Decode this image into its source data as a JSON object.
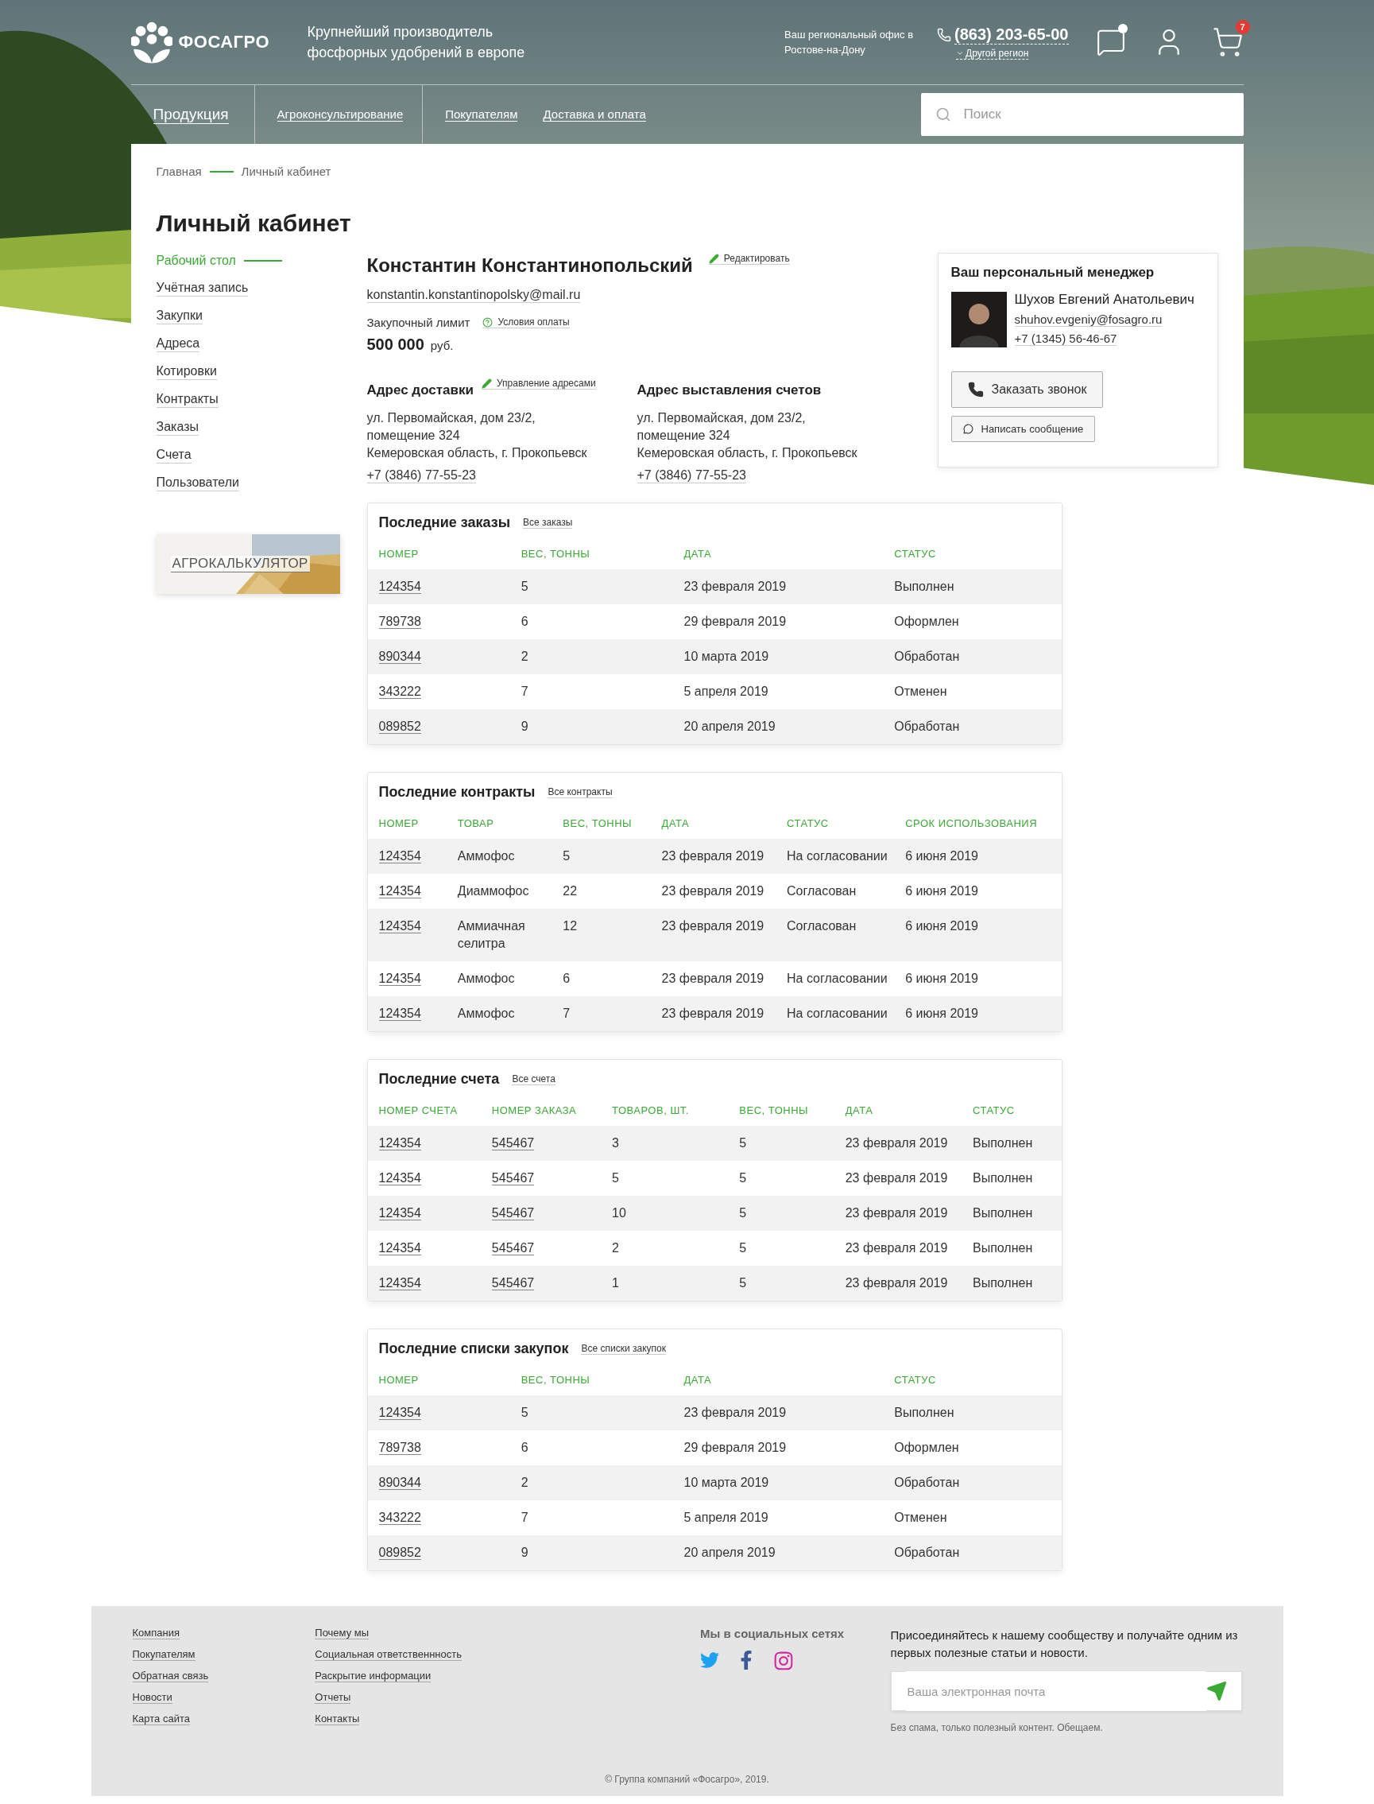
{
  "header": {
    "brand": "ФОСАГРО",
    "tagline": "Крупнейший производитель фосфорных удобрений в европе",
    "office": "Ваш региональный офис в Ростове-на-Дону",
    "phone": "(863) 203-65-00",
    "region_link": "Другой регион",
    "cart_count": "7"
  },
  "nav": [
    {
      "label": "Продукция",
      "selected": true
    },
    {
      "label": "Агроконсультирование",
      "selected": false
    },
    {
      "label": "Покупателям",
      "selected": false
    },
    {
      "label": "Доставка и оплата",
      "selected": false
    }
  ],
  "search": {
    "placeholder": "Поиск"
  },
  "breadcrumbs": [
    "Главная",
    "Личный кабинет"
  ],
  "page_title": "Личный кабинет",
  "sidebar": {
    "items": [
      {
        "label": "Рабочий стол",
        "selected": true
      },
      {
        "label": "Учётная запись",
        "selected": false
      },
      {
        "label": "Закупки",
        "selected": false
      },
      {
        "label": "Адреса",
        "selected": false
      },
      {
        "label": "Котировки",
        "selected": false
      },
      {
        "label": "Контракты",
        "selected": false
      },
      {
        "label": "Заказы",
        "selected": false
      },
      {
        "label": "Счета",
        "selected": false
      },
      {
        "label": "Пользователи",
        "selected": false
      }
    ],
    "banner": {
      "kind": "picture",
      "label": "АГРОКАЛЬКУЛЯТОР"
    }
  },
  "profile": {
    "name": "Константин Константинопольский",
    "edit_link": "Редактировать",
    "email": "konstantin.konstantinopolsky@mail.ru",
    "limit_label": "Закупочный лимит",
    "terms_link": "Условия оплаты",
    "limit_value": "500 000",
    "currency": "руб."
  },
  "addresses": [
    {
      "title": "Адрес доставки",
      "manage_link": "Управление адресами",
      "lines": [
        "ул. Первомайская, дом 23/2,",
        "помещение 324",
        "Кемеровская область, г. Прокопьевск"
      ],
      "phone": "+7 (3846) 77-55-23"
    },
    {
      "title": "Адрес выставления счетов",
      "lines": [
        "ул. Первомайская, дом 23/2,",
        "помещение 324",
        "Кемеровская область, г. Прокопьевск"
      ],
      "phone": "+7 (3846) 77-55-23"
    }
  ],
  "manager": {
    "title": "Ваш персональный менеджер",
    "name": "Шухов Евгений Анатольевич",
    "email": "shuhov.evgeniy@fosagro.ru",
    "phone": "+7 (1345) 56-46-67",
    "call_button": "Заказать звонок",
    "message_button": "Написать сообщение"
  },
  "tables": [
    {
      "title": "Последние заказы",
      "all_link": "Все заказы",
      "columns": [
        {
          "label": "НОМЕР",
          "kind": "link"
        },
        {
          "label": "ВЕС, ТОННЫ",
          "kind": "text"
        },
        {
          "label": "ДАТА",
          "kind": "text"
        },
        {
          "label": "СТАТУС",
          "kind": "text"
        }
      ],
      "rows": [
        [
          "124354",
          "5",
          "23 февраля 2019",
          "Выполнен"
        ],
        [
          "789738",
          "6",
          "29 февраля 2019",
          "Оформлен"
        ],
        [
          "890344",
          "2",
          "10 марта 2019",
          "Обработан"
        ],
        [
          "343222",
          "7",
          "5 апреля 2019",
          "Отменен"
        ],
        [
          "089852",
          "9",
          "20 апреля 2019",
          "Обработан"
        ]
      ]
    },
    {
      "title": "Последние контракты",
      "all_link": "Все контракты",
      "columns": [
        {
          "label": "НОМЕР",
          "kind": "link"
        },
        {
          "label": "ТОВАР",
          "kind": "text"
        },
        {
          "label": "ВЕС, ТОННЫ",
          "kind": "text"
        },
        {
          "label": "ДАТА",
          "kind": "text"
        },
        {
          "label": "СТАТУС",
          "kind": "text"
        },
        {
          "label": "СРОК ИСПОЛЬЗОВАНИЯ",
          "kind": "text"
        }
      ],
      "rows": [
        [
          "124354",
          "Аммофос",
          "5",
          "23 февраля 2019",
          "На согласовании",
          "6 июня 2019"
        ],
        [
          "124354",
          "Диаммофос",
          "22",
          "23 февраля 2019",
          "Согласован",
          "6 июня 2019"
        ],
        [
          "124354",
          "Аммиачная селитра",
          "12",
          "23 февраля 2019",
          "Согласован",
          "6 июня 2019"
        ],
        [
          "124354",
          "Аммофос",
          "6",
          "23 февраля 2019",
          "На согласовании",
          "6 июня 2019"
        ],
        [
          "124354",
          "Аммофос",
          "7",
          "23 февраля 2019",
          "На согласовании",
          "6 июня 2019"
        ]
      ]
    },
    {
      "title": "Последние счета",
      "all_link": "Все счета",
      "columns": [
        {
          "label": "НОМЕР СЧЕТА",
          "kind": "link"
        },
        {
          "label": "НОМЕР ЗАКАЗА",
          "kind": "link"
        },
        {
          "label": "ТОВАРОВ, ШТ.",
          "kind": "text"
        },
        {
          "label": "ВЕС, ТОННЫ",
          "kind": "text"
        },
        {
          "label": "ДАТА",
          "kind": "text"
        },
        {
          "label": "СТАТУС",
          "kind": "text"
        }
      ],
      "rows": [
        [
          "124354",
          "545467",
          "3",
          "5",
          "23 февраля 2019",
          "Выполнен"
        ],
        [
          "124354",
          "545467",
          "5",
          "5",
          "23 февраля 2019",
          "Выполнен"
        ],
        [
          "124354",
          "545467",
          "10",
          "5",
          "23 февраля 2019",
          "Выполнен"
        ],
        [
          "124354",
          "545467",
          "2",
          "5",
          "23 февраля 2019",
          "Выполнен"
        ],
        [
          "124354",
          "545467",
          "1",
          "5",
          "23 февраля 2019",
          "Выполнен"
        ]
      ]
    },
    {
      "title": "Последние списки закупок",
      "all_link": "Все списки закупок",
      "columns": [
        {
          "label": "НОМЕР",
          "kind": "link"
        },
        {
          "label": "ВЕС, ТОННЫ",
          "kind": "text"
        },
        {
          "label": "ДАТА",
          "kind": "text"
        },
        {
          "label": "СТАТУС",
          "kind": "text"
        }
      ],
      "rows": [
        [
          "124354",
          "5",
          "23 февраля 2019",
          "Выполнен"
        ],
        [
          "789738",
          "6",
          "29 февраля 2019",
          "Оформлен"
        ],
        [
          "890344",
          "2",
          "10 марта 2019",
          "Обработан"
        ],
        [
          "343222",
          "7",
          "5 апреля 2019",
          "Отменен"
        ],
        [
          "089852",
          "9",
          "20 апреля 2019",
          "Обработан"
        ]
      ]
    }
  ],
  "footer": {
    "columns": [
      [
        "Компания",
        "Покупателям",
        "Обратная связь",
        "Новости",
        "Карта сайта"
      ],
      [
        "Почему мы",
        "Социальная ответственнность",
        "Раскрытие информации",
        "Отчеты",
        "Контакты"
      ]
    ],
    "social_title": "Мы в социальных сетях",
    "subscribe_text": "Присоединяйтесь к нашему сообществу и получайте одним из первых полезные статьи и новости.",
    "email_placeholder": "Ваша электронная почта",
    "note": "Без спама, только полезный контент. Обещаем.",
    "copyright": "© Группа компаний «Фосагро», 2019."
  }
}
